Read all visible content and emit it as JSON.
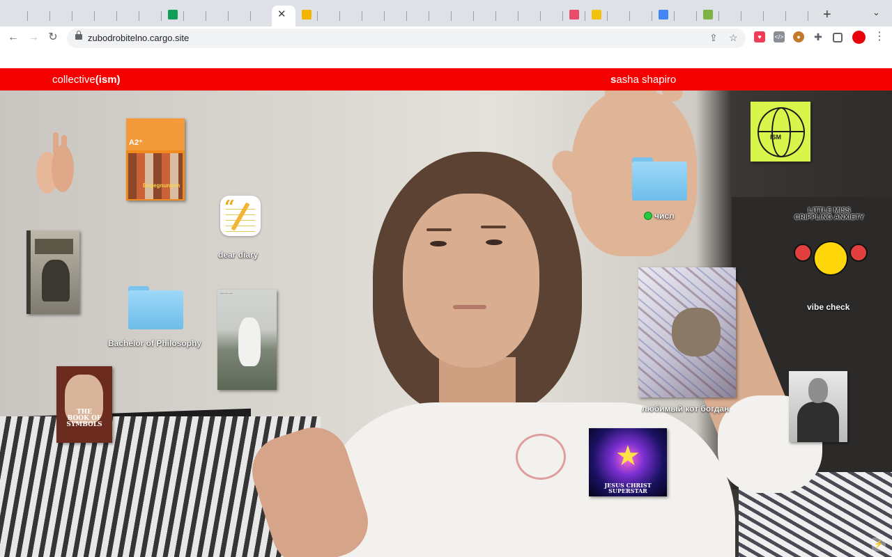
{
  "browser": {
    "tabs_count": 36,
    "active_tab_close": "✕",
    "new_tab": "+",
    "tab_menu": "⌄",
    "url": "zubodrobitelno.cargo.site",
    "nav": {
      "back": "←",
      "forward": "→",
      "reload": "↻"
    },
    "omni_icons": {
      "share": "⇪",
      "bookmark": "☆"
    },
    "colors": {
      "tabstrip": "#dee1e6",
      "profile": "#e8000d"
    },
    "icons": [
      "pocket-icon",
      "code-icon",
      "bear-icon",
      "puzzle-icon",
      "sidebar-icon"
    ]
  },
  "site": {
    "banner": {
      "title_prefix": "collective",
      "title_bold": "(ism)",
      "name_bold": "s",
      "name_rest": "asha shapiro",
      "color": "#f50000"
    },
    "desktop_items": {
      "dear_diary": "dear diary",
      "bachelor": "Bachelor of Philosophy",
      "chisl": "числ",
      "cat": "любимый кот богдан",
      "vibe": "vibe check",
      "a2": "A2⁺",
      "begegnungen": "Begegnungen",
      "symbols": "THE BOOK OF SYMBOLS",
      "ism": "ISM",
      "little_miss": "LITTLE MISS CRIPPLING ANXIETY",
      "jcs": "JESUS CHRIST SUPERSTAR"
    },
    "corner_icon": "⚡"
  }
}
